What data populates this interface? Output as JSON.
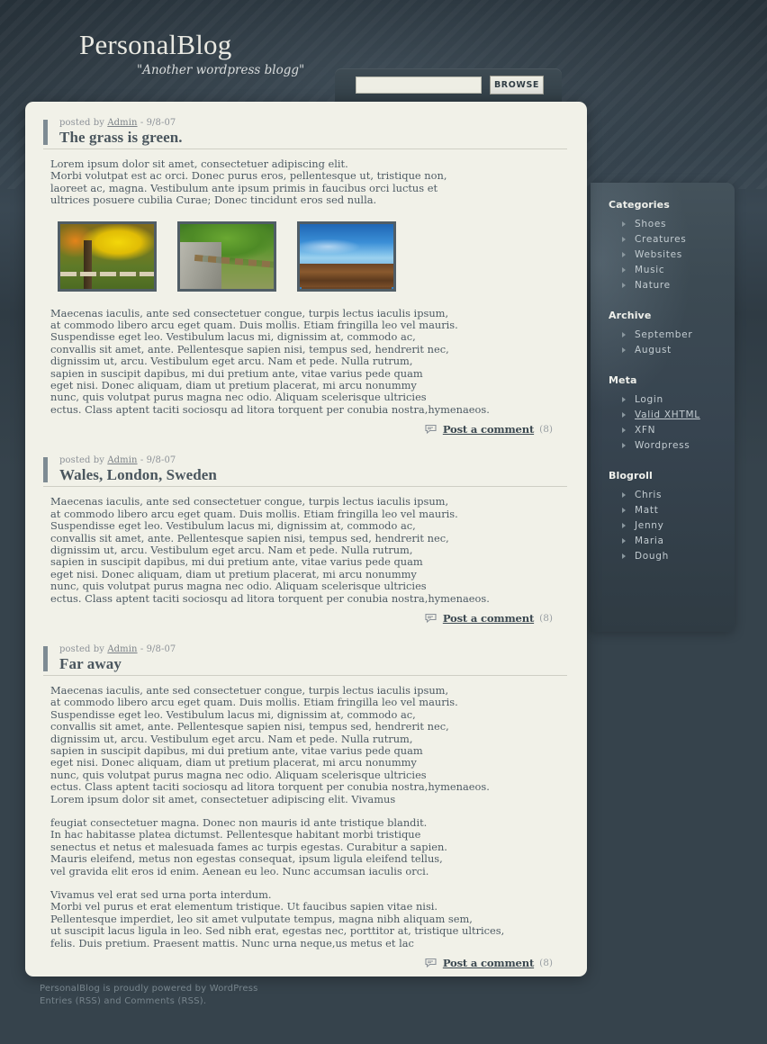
{
  "site": {
    "title": "PersonalBlog",
    "tagline": "\"Another wordpress blogg\""
  },
  "search": {
    "value": "",
    "placeholder": "",
    "button_label": "BROWSE"
  },
  "sidebar": {
    "sections": [
      {
        "title": "Categories",
        "items": [
          {
            "label": "Shoes"
          },
          {
            "label": "Creatures"
          },
          {
            "label": "Websites"
          },
          {
            "label": "Music"
          },
          {
            "label": "Nature"
          }
        ]
      },
      {
        "title": "Archive",
        "items": [
          {
            "label": "September"
          },
          {
            "label": "August"
          }
        ]
      },
      {
        "title": "Meta",
        "items": [
          {
            "label": "Login"
          },
          {
            "label": "Valid XHTML"
          },
          {
            "label": "XFN"
          },
          {
            "label": "Wordpress"
          }
        ]
      },
      {
        "title": "Blogroll",
        "items": [
          {
            "label": "Chris"
          },
          {
            "label": "Matt"
          },
          {
            "label": "Jenny"
          },
          {
            "label": "Maria"
          },
          {
            "label": "Dough"
          }
        ]
      }
    ]
  },
  "posts": [
    {
      "meta_prefix": "posted by ",
      "author": "Admin",
      "meta_suffix": " - 9/8-07",
      "title": "The grass is green.",
      "body_1": "Lorem ipsum dolor sit amet, consectetuer adipiscing elit.\nMorbi volutpat est ac orci. Donec purus eros, pellentesque ut, tristique non,\nlaoreet ac, magna. Vestibulum ante ipsum primis in faucibus orci luctus et\nultrices posuere cubilia Curae; Donec tincidunt eros sed nulla.",
      "images": [
        {
          "alt": "autumn-trees-fence"
        },
        {
          "alt": "green-fence-path"
        },
        {
          "alt": "wooden-fence-sky"
        }
      ],
      "body_2": "Maecenas iaculis, ante sed consectetuer congue, turpis lectus iaculis ipsum,\nat commodo libero arcu eget quam. Duis mollis. Etiam fringilla leo vel mauris.\nSuspendisse eget leo. Vestibulum lacus mi, dignissim at, commodo ac,\nconvallis sit amet, ante. Pellentesque sapien nisi, tempus sed, hendrerit nec,\ndignissim ut, arcu. Vestibulum eget arcu. Nam et pede. Nulla rutrum,\nsapien in suscipit dapibus, mi dui pretium ante, vitae varius pede quam\neget nisi. Donec aliquam, diam ut pretium placerat, mi arcu nonummy\nnunc, quis volutpat purus magna nec odio. Aliquam scelerisque ultricies\nectus. Class aptent taciti sociosqu ad litora torquent per conubia nostra,hymenaeos.",
      "comment_label": "Post a comment",
      "comment_count": "(8)"
    },
    {
      "meta_prefix": "posted by ",
      "author": "Admin",
      "meta_suffix": " - 9/8-07",
      "title": "Wales, London, Sweden",
      "body_1": "Maecenas iaculis, ante sed consectetuer congue, turpis lectus iaculis ipsum,\nat commodo libero arcu eget quam. Duis mollis. Etiam fringilla leo vel mauris.\nSuspendisse eget leo. Vestibulum lacus mi, dignissim at, commodo ac,\nconvallis sit amet, ante. Pellentesque sapien nisi, tempus sed, hendrerit nec,\ndignissim ut, arcu. Vestibulum eget arcu. Nam et pede. Nulla rutrum,\nsapien in suscipit dapibus, mi dui pretium ante, vitae varius pede quam\neget nisi. Donec aliquam, diam ut pretium placerat, mi arcu nonummy\nnunc, quis volutpat purus magna nec odio. Aliquam scelerisque ultricies\nectus. Class aptent taciti sociosqu ad litora torquent per conubia nostra,hymenaeos.",
      "comment_label": "Post a comment",
      "comment_count": "(8)"
    },
    {
      "meta_prefix": "posted by ",
      "author": "Admin",
      "meta_suffix": " - 9/8-07",
      "title": "Far away",
      "body_1": "Maecenas iaculis, ante sed consectetuer congue, turpis lectus iaculis ipsum,\nat commodo libero arcu eget quam. Duis mollis. Etiam fringilla leo vel mauris.\nSuspendisse eget leo. Vestibulum lacus mi, dignissim at, commodo ac,\nconvallis sit amet, ante. Pellentesque sapien nisi, tempus sed, hendrerit nec,\ndignissim ut, arcu. Vestibulum eget arcu. Nam et pede. Nulla rutrum,\nsapien in suscipit dapibus, mi dui pretium ante, vitae varius pede quam\neget nisi. Donec aliquam, diam ut pretium placerat, mi arcu nonummy\nnunc, quis volutpat purus magna nec odio. Aliquam scelerisque ultricies\nectus. Class aptent taciti sociosqu ad litora torquent per conubia nostra,hymenaeos.\nLorem ipsum dolor sit amet, consectetuer adipiscing elit. Vivamus",
      "body_2": "feugiat consectetuer magna. Donec non mauris id ante tristique blandit.\nIn hac habitasse platea dictumst. Pellentesque habitant morbi tristique\nsenectus et netus et malesuada fames ac turpis egestas. Curabitur a sapien.\nMauris eleifend, metus non egestas consequat, ipsum ligula eleifend tellus,\nvel gravida elit eros id enim. Aenean eu leo. Nunc accumsan iaculis orci.",
      "body_3": "Vivamus vel erat sed urna porta interdum.\nMorbi vel purus et erat elementum tristique. Ut faucibus sapien vitae nisi.\nPellentesque imperdiet, leo sit amet vulputate tempus, magna nibh aliquam sem,\nut suscipit lacus ligula in leo. Sed nibh erat, egestas nec, porttitor at, tristique ultrices,\nfelis. Duis pretium. Praesent mattis. Nunc urna neque,us metus et lac",
      "comment_label": "Post a comment",
      "comment_count": "(8)"
    }
  ],
  "footer": {
    "line1": "PersonalBlog is proudly powered by WordPress",
    "line2": "Entries (RSS) and Comments (RSS)."
  },
  "colors": {
    "page_bg": "#36434c",
    "card_bg": "#f1f1e8",
    "text": "#4d5a63",
    "heading": "#4a565e",
    "sidebar_text": "#c3ccd1",
    "muted": "#8d9298"
  }
}
